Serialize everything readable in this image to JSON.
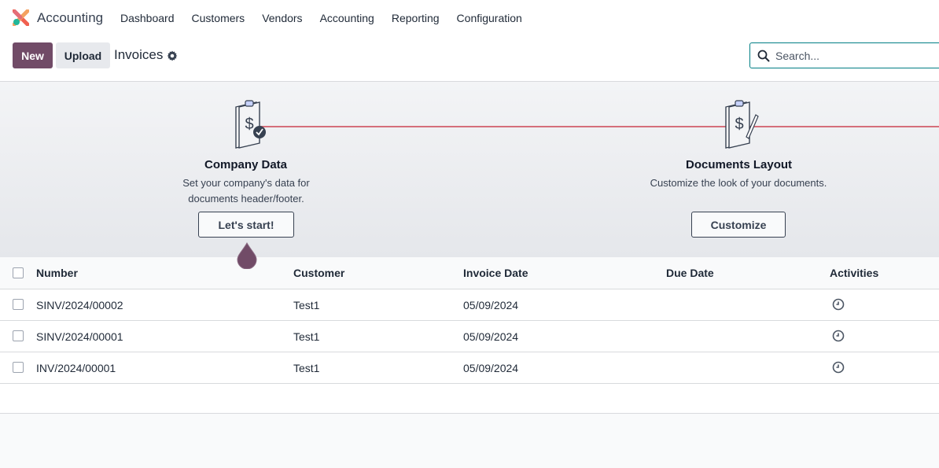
{
  "navbar": {
    "app_name": "Accounting",
    "menu": [
      "Dashboard",
      "Customers",
      "Vendors",
      "Accounting",
      "Reporting",
      "Configuration"
    ]
  },
  "control": {
    "new_label": "New",
    "upload_label": "Upload",
    "breadcrumb": "Invoices",
    "search_placeholder": "Search..."
  },
  "onboarding": {
    "steps": [
      {
        "title": "Company Data",
        "description_lines": [
          "Set your company's data for",
          "documents header/footer."
        ],
        "button": "Let's start!"
      },
      {
        "title": "Documents Layout",
        "description_lines": [
          "Customize the look of your documents."
        ],
        "button": "Customize"
      }
    ]
  },
  "table": {
    "headers": [
      "Number",
      "Customer",
      "Invoice Date",
      "Due Date",
      "Activities"
    ],
    "rows": [
      {
        "number": "SINV/2024/00002",
        "customer": "Test1",
        "invoice_date": "05/09/2024",
        "due_date": ""
      },
      {
        "number": "SINV/2024/00001",
        "customer": "Test1",
        "invoice_date": "05/09/2024",
        "due_date": ""
      },
      {
        "number": "INV/2024/00001",
        "customer": "Test1",
        "invoice_date": "05/09/2024",
        "due_date": ""
      }
    ]
  },
  "colors": {
    "primary": "#714b67",
    "step_line": "#d56f7b",
    "search_border": "#017e84"
  },
  "icons": {
    "logo": "odoo-accounting-logo",
    "settings": "gear-icon",
    "search": "search-icon",
    "activity": "clock-icon",
    "company_step": "clipboard-dollar-check-icon",
    "layout_step": "clipboard-dollar-pen-icon"
  }
}
